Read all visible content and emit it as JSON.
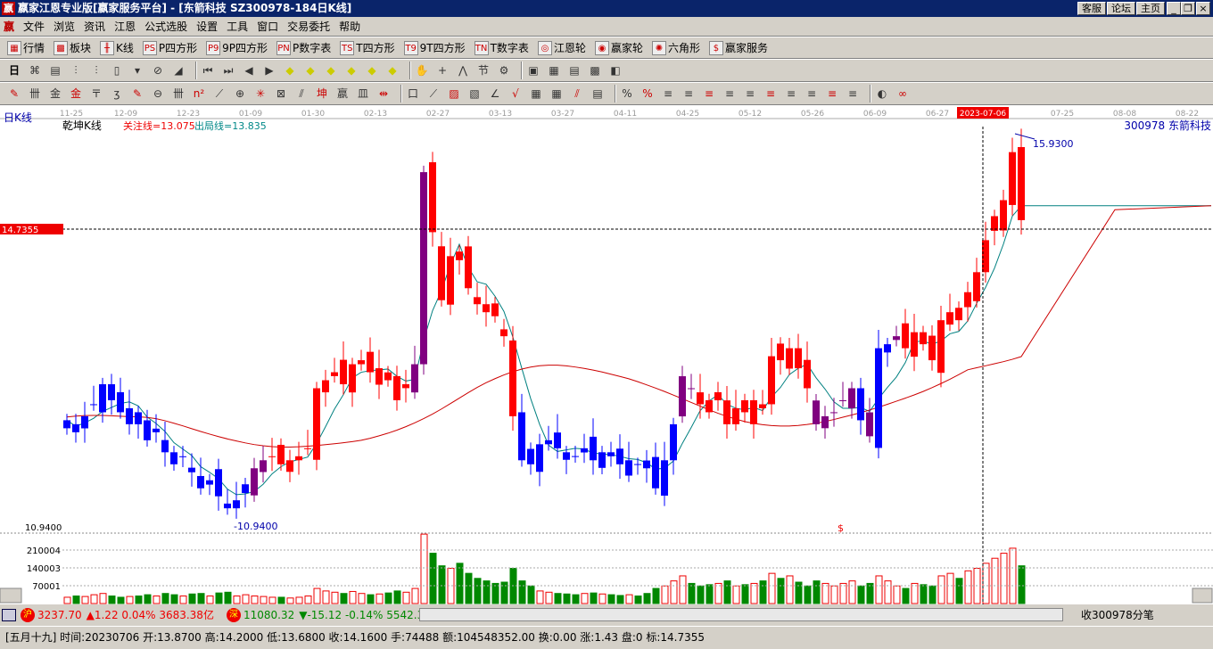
{
  "window": {
    "title": "嬴家江恩专业版[嬴家服务平台] - [东箭科技   SZ300978-184日K线]",
    "logo": "嬴",
    "buttons": [
      "客服",
      "论坛",
      "主页"
    ]
  },
  "menu": [
    "文件",
    "浏览",
    "资讯",
    "江恩",
    "公式选股",
    "设置",
    "工具",
    "窗口",
    "交易委托",
    "帮助"
  ],
  "toolbar1": [
    {
      "icon": "grid-table-icon",
      "glyph": "▦",
      "label": "行情"
    },
    {
      "icon": "blocks-icon",
      "glyph": "▩",
      "label": "板块"
    },
    {
      "icon": "kline-icon",
      "glyph": "╫",
      "label": "K线"
    },
    {
      "icon": "ps-icon",
      "glyph": "PS",
      "label": "P四方形"
    },
    {
      "icon": "p9-icon",
      "glyph": "P9",
      "label": "9P四方形"
    },
    {
      "icon": "pn-icon",
      "glyph": "PN",
      "label": "P数字表"
    },
    {
      "icon": "ts-icon",
      "glyph": "TS",
      "label": "T四方形"
    },
    {
      "icon": "t9-icon",
      "glyph": "T9",
      "label": "9T四方形"
    },
    {
      "icon": "tn-icon",
      "glyph": "TN",
      "label": "T数字表"
    },
    {
      "icon": "gann-wheel-icon",
      "glyph": "◎",
      "label": "江恩轮"
    },
    {
      "icon": "win-wheel-icon",
      "glyph": "◉",
      "label": "嬴家轮"
    },
    {
      "icon": "hexagon-icon",
      "glyph": "✺",
      "label": "六角形"
    },
    {
      "icon": "service-icon",
      "glyph": "$",
      "label": "嬴家服务"
    }
  ],
  "toolbar2": {
    "period": "日",
    "glyphs": [
      "⌘",
      "▤",
      "⫶",
      "⫶",
      "▯",
      "▾",
      "⊘",
      "◢",
      "⏮",
      "⏭",
      "◀",
      "▶",
      "◆",
      "◆",
      "◆",
      "◆",
      "◆",
      "◆",
      "✋",
      "+",
      "⋀",
      "节",
      "⚙",
      "▣",
      "▦",
      "▤",
      "▩",
      "◧"
    ]
  },
  "toolbar3": {
    "glyphs": [
      "✎",
      "卌",
      "金",
      "金",
      "〒",
      "ʒ",
      "✎",
      "⊖",
      "卌",
      "n²",
      "⟋",
      "⊕",
      "✳",
      "⊠",
      "⫽",
      "坤",
      "嬴",
      "皿",
      "⇹",
      "口",
      "⟋",
      "▨",
      "▧",
      "∠",
      "√",
      "▦",
      "▦",
      "⫽",
      "▤",
      "%",
      "%",
      "≡",
      "≡",
      "≡",
      "≡",
      "≡",
      "≡",
      "≡",
      "≡",
      "≡",
      "≡",
      "◐",
      "∞"
    ]
  },
  "chart": {
    "period_label": "日K线",
    "indicator": "乾坤K线",
    "line1": "关注线=13.075",
    "line2": "出局线=13.835",
    "stock": "300978  东箭科技",
    "dates": [
      "11-25",
      "12-09",
      "12-23",
      "01-09",
      "01-30",
      "02-13",
      "02-27",
      "03-13",
      "03-27",
      "04-11",
      "04-25",
      "05-12",
      "05-26",
      "06-09",
      "06-27",
      "2023-07-06",
      "07-25",
      "08-08",
      "08-22"
    ],
    "crosshair_price": "14.7355",
    "high_label": "15.9300",
    "low_label": "10.9400",
    "low_axis": "10.9400",
    "marker": "$",
    "vol_ticks": [
      "210004",
      "140003",
      "70001"
    ],
    "colors": {
      "up": "#ff0000",
      "down": "#0000ff",
      "neutral": "#800080",
      "ma_short": "#008080",
      "ma_long": "#cc0000"
    }
  },
  "chart_data": {
    "type": "candlestick",
    "ylim": [
      10.94,
      15.93
    ],
    "closes": [
      12.35,
      12.2,
      12.4,
      12.55,
      12.8,
      12.6,
      12.45,
      12.5,
      12.3,
      12.1,
      12.2,
      11.95,
      11.8,
      11.9,
      11.7,
      11.5,
      11.6,
      11.4,
      11.25,
      11.35,
      11.55,
      11.75,
      11.85,
      11.9,
      11.8,
      11.85,
      11.9,
      12.0,
      12.75,
      12.85,
      12.95,
      12.8,
      13.05,
      13.1,
      12.95,
      13.0,
      12.85,
      12.6,
      12.8,
      13.05,
      15.45,
      14.7,
      13.85,
      14.4,
      14.35,
      14.0,
      13.8,
      13.7,
      13.65,
      13.4,
      12.4,
      11.85,
      11.8,
      12.05,
      12.1,
      12.0,
      11.95,
      11.9,
      12.0,
      11.85,
      11.95,
      11.9,
      11.8,
      11.85,
      11.8,
      11.75,
      11.5,
      11.85,
      12.3,
      12.9,
      12.75,
      12.55,
      12.45,
      12.7,
      12.3,
      12.5,
      12.45,
      12.6,
      12.5,
      13.15,
      13.1,
      13.25,
      13.0,
      12.75,
      12.3,
      12.4,
      12.45,
      12.6,
      12.75,
      12.35,
      12.15,
      13.25,
      13.3,
      13.4,
      13.25,
      13.45,
      13.3,
      13.1,
      13.6,
      13.7,
      13.6,
      13.95,
      14.2,
      14.6,
      14.9,
      15.1,
      15.7,
      14.85
    ],
    "states": "bbbbbbbbbbbbbbbbbbbbbpprrrrrrrrrrrrrrrrpprrrrrrrrrrbbbbbbbbbbbbbbbbbbpprrrrrrrrrrrrrpppppbpbbprrrrrrrrrrrrrrrrrr",
    "volumes": [
      25000,
      30000,
      28000,
      35000,
      40000,
      30000,
      25000,
      28000,
      30000,
      35000,
      30000,
      40000,
      35000,
      30000,
      38000,
      40000,
      30000,
      42000,
      45000,
      30000,
      35000,
      30000,
      28000,
      25000,
      25000,
      22000,
      25000,
      30000,
      60000,
      50000,
      45000,
      40000,
      48000,
      40000,
      35000,
      38000,
      42000,
      50000,
      45000,
      60000,
      276000,
      200000,
      150000,
      140000,
      160000,
      120000,
      100000,
      90000,
      80000,
      85000,
      140000,
      90000,
      70000,
      50000,
      45000,
      40000,
      38000,
      35000,
      40000,
      42000,
      38000,
      35000,
      32000,
      35000,
      30000,
      40000,
      60000,
      70000,
      90000,
      110000,
      80000,
      70000,
      75000,
      80000,
      90000,
      70000,
      75000,
      80000,
      90000,
      120000,
      100000,
      110000,
      85000,
      70000,
      90000,
      80000,
      70000,
      80000,
      90000,
      70000,
      80000,
      110000,
      90000,
      70000,
      60000,
      80000,
      75000,
      70000,
      110000,
      120000,
      100000,
      130000,
      140000,
      160000,
      180000,
      200000,
      220000,
      150000
    ]
  },
  "status1": {
    "sh_badge": "沪",
    "sh": "3237.70",
    "sh_chg": "▲1.22 0.04% 3683.38亿",
    "sz_badge": "深",
    "sz": "11080.32",
    "sz_chg": "▼-15.12 -0.14% 5542.3",
    "right": "收300978分笔"
  },
  "status2": "[五月十九] 时间:20230706 开:13.8700 高:14.2000 低:13.6800 收:14.1600 手:74488 额:104548352.00 换:0.00 涨:1.43 盘:0 标:14.7355"
}
